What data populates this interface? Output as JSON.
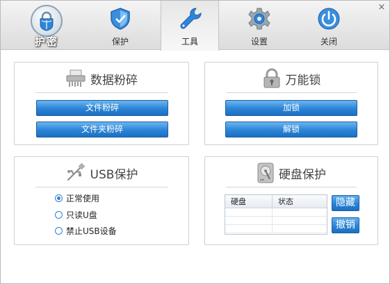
{
  "header": {
    "brand": "护密",
    "tabs": [
      {
        "label": "保护",
        "icon": "shield-icon"
      },
      {
        "label": "工具",
        "icon": "wrench-icon",
        "active": true
      },
      {
        "label": "设置",
        "icon": "gear-icon"
      },
      {
        "label": "关闭",
        "icon": "power-icon"
      }
    ],
    "close": "×"
  },
  "shred": {
    "title": "数据粉碎",
    "file_button": "文件粉碎",
    "folder_button": "文件夹粉碎"
  },
  "lock": {
    "title": "万能锁",
    "lock_button": "加锁",
    "unlock_button": "解锁"
  },
  "usb": {
    "title": "USB保护",
    "options": [
      {
        "label": "正常使用",
        "checked": true
      },
      {
        "label": "只读U盘",
        "checked": false
      },
      {
        "label": "禁止USB设备",
        "checked": false
      }
    ]
  },
  "disk": {
    "title": "硬盘保护",
    "columns": [
      "硬盘",
      "状态"
    ],
    "hide_button": "隐藏",
    "revoke_button": "撤销"
  },
  "colors": {
    "accent": "#2a84d6",
    "icon_blue": "#2e86d8"
  }
}
